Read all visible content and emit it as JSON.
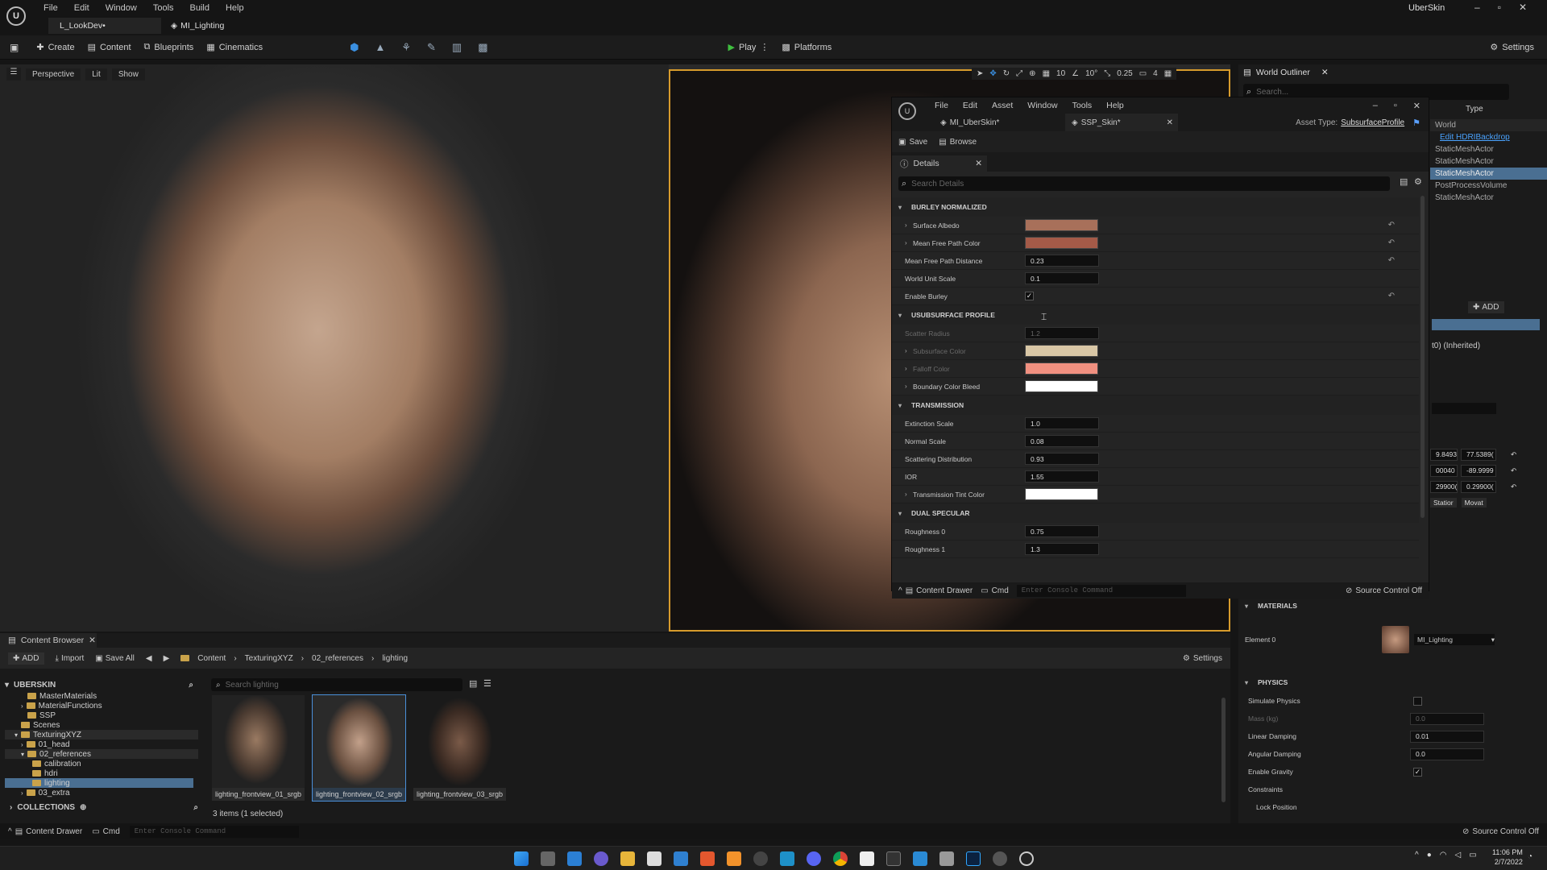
{
  "app": {
    "title": "UberSkin",
    "menu": [
      "File",
      "Edit",
      "Window",
      "Tools",
      "Build",
      "Help"
    ],
    "tabs": [
      "L_LookDev•",
      "MI_Lighting"
    ]
  },
  "toolbar": {
    "create": "Create",
    "content": "Content",
    "blueprints": "Blueprints",
    "cinematics": "Cinematics",
    "play": "Play",
    "platforms": "Platforms",
    "settings": "Settings"
  },
  "viewport": {
    "perspective": "Perspective",
    "lit": "Lit",
    "show": "Show",
    "snap_grid": "10",
    "snap_angle": "10°",
    "snap_scale": "0.25",
    "camera_speed": "4"
  },
  "outliner": {
    "title": "World Outliner",
    "search_placeholder": "Search...",
    "type_header": "Type",
    "items": [
      "World",
      "Edit HDRIBackdrop",
      "StaticMeshActor",
      "StaticMeshActor",
      "StaticMeshActor",
      "PostProcessVolume",
      "StaticMeshActor"
    ]
  },
  "material_window": {
    "menu": [
      "File",
      "Edit",
      "Asset",
      "Window",
      "Tools",
      "Help"
    ],
    "tab1": "MI_UberSkin*",
    "tab2": "SSP_Skin*",
    "asset_type_label": "Asset Type:",
    "asset_type_value": "SubsurfaceProfile",
    "save": "Save",
    "browse": "Browse",
    "details_tab": "Details",
    "search_placeholder": "Search Details",
    "sections": {
      "burley": "BURLEY NORMALIZED",
      "subsurface": "USUBSURFACE PROFILE",
      "transmission": "TRANSMISSION",
      "dual": "DUAL SPECULAR"
    },
    "props": {
      "surface_albedo": "Surface Albedo",
      "mean_free_path_color": "Mean Free Path Color",
      "mean_free_path_distance": "Mean Free Path Distance",
      "mean_free_path_distance_value": "0.23",
      "world_unit_scale": "World Unit Scale",
      "world_unit_scale_value": "0.1",
      "enable_burley": "Enable Burley",
      "scatter_radius": "Scatter Radius",
      "scatter_radius_value": "1.2",
      "subsurface_color": "Subsurface Color",
      "falloff_color": "Falloff Color",
      "boundary_color_bleed": "Boundary Color Bleed",
      "extinction_scale": "Extinction Scale",
      "extinction_scale_value": "1.0",
      "normal_scale": "Normal Scale",
      "normal_scale_value": "0.08",
      "scattering_distribution": "Scattering Distribution",
      "scattering_distribution_value": "0.93",
      "ior": "IOR",
      "ior_value": "1.55",
      "transmission_tint_color": "Transmission Tint Color",
      "roughness0": "Roughness 0",
      "roughness0_value": "0.75",
      "roughness1": "Roughness 1",
      "roughness1_value": "1.3"
    },
    "footer": {
      "content_drawer": "Content Drawer",
      "cmd": "Cmd",
      "console_placeholder": "Enter Console Command",
      "source_control": "Source Control Off"
    }
  },
  "details_right": {
    "add": "ADD",
    "inherited": "t0) (Inherited)",
    "loc": [
      "9.8493",
      "77.5389("
    ],
    "rot": [
      "00040",
      "-89.9999"
    ],
    "scale": [
      "29900(",
      "0.29900("
    ],
    "mobility": [
      "Statior",
      "Movat"
    ],
    "materials_header": "MATERIALS",
    "element0": "Element 0",
    "material_name": "MI_Lighting",
    "physics_header": "PHYSICS",
    "simulate_physics": "Simulate Physics",
    "mass": "Mass (kg)",
    "mass_value": "0.0",
    "linear_damping": "Linear Damping",
    "linear_damping_value": "0.01",
    "angular_damping": "Angular Damping",
    "angular_damping_value": "0.0",
    "enable_gravity": "Enable Gravity",
    "constraints": "Constraints",
    "lock_position": "Lock Position"
  },
  "content_browser": {
    "title": "Content Browser",
    "add": "ADD",
    "import": "Import",
    "save_all": "Save All",
    "path": [
      "Content",
      "TexturingXYZ",
      "02_references",
      "lighting"
    ],
    "settings": "Settings",
    "root": "UBERSKIN",
    "search_placeholder": "Search lighting",
    "tree": [
      "MasterMaterials",
      "MaterialFunctions",
      "SSP",
      "Scenes",
      "TexturingXYZ",
      "01_head",
      "02_references",
      "calibration",
      "hdri",
      "lighting",
      "03_extra"
    ],
    "collections": "COLLECTIONS",
    "assets": [
      "lighting_frontview_01_srgb",
      "lighting_frontview_02_srgb",
      "lighting_frontview_03_srgb"
    ],
    "status": "3 items (1 selected)"
  },
  "bottom": {
    "content_drawer": "Content Drawer",
    "cmd": "Cmd",
    "console_placeholder": "Enter Console Command",
    "source_control": "Source Control Off"
  },
  "clock": {
    "time": "11:06 PM",
    "date": "2/7/2022"
  },
  "colors": {
    "surface_albedo": "#a8705a",
    "mean_free_path_color": "#a45a48",
    "subsurface_color": "#d9c7a6",
    "falloff_color": "#f09080",
    "boundary_color_bleed": "#ffffff",
    "transmission_tint": "#ffffff",
    "accent": "#d79b2c"
  }
}
